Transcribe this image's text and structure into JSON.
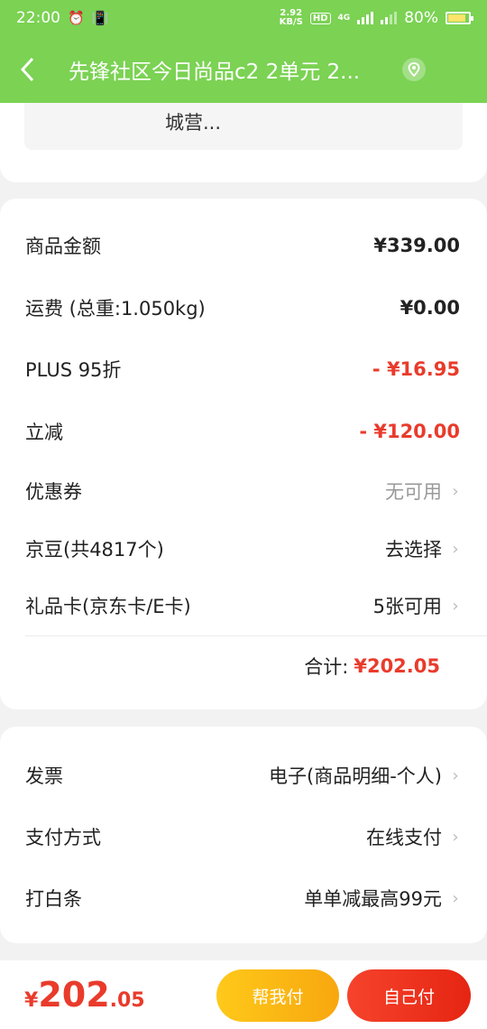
{
  "status_bar": {
    "time": "22:00",
    "net_speed_value": "2.92",
    "net_speed_unit": "KB/S",
    "hd": "HD",
    "network": "4G",
    "battery": "80%"
  },
  "header": {
    "title": "先锋社区今日尚品c2 2单元 2..."
  },
  "address": {
    "text": "城营..."
  },
  "amount": {
    "rows": [
      {
        "label": "商品金额",
        "value": "¥339.00"
      },
      {
        "label": "运费 (总重:1.050kg)",
        "value": "¥0.00"
      },
      {
        "label": "PLUS 95折",
        "value": "- ¥16.95"
      },
      {
        "label": "立减",
        "value": "- ¥120.00"
      },
      {
        "label": "优惠券",
        "value": "无可用"
      },
      {
        "label": "京豆(共4817个)",
        "value": "去选择"
      },
      {
        "label": "礼品卡(京东卡/E卡)",
        "value": "5张可用"
      }
    ],
    "total_label": "合计:",
    "total_value": "¥202.05"
  },
  "payment": {
    "rows": [
      {
        "label": "发票",
        "value": "电子(商品明细-个人)"
      },
      {
        "label": "支付方式",
        "value": "在线支付"
      },
      {
        "label": "打白条",
        "value": "单单减最高99元"
      }
    ]
  },
  "bottom": {
    "currency": "¥",
    "price_int": "202",
    "price_dec": ".05",
    "help_pay_label": "帮我付",
    "self_pay_label": "自己付"
  },
  "colors": {
    "header_green": "#7bd253",
    "price_red": "#e93b2b",
    "help_button": "#f7a70e",
    "self_button": "#e52512"
  },
  "icons": [
    "alarm-icon",
    "vibrate-icon",
    "signal-icon",
    "battery-icon",
    "back-arrow-icon",
    "location-pin-icon",
    "chevron-right-icon"
  ]
}
